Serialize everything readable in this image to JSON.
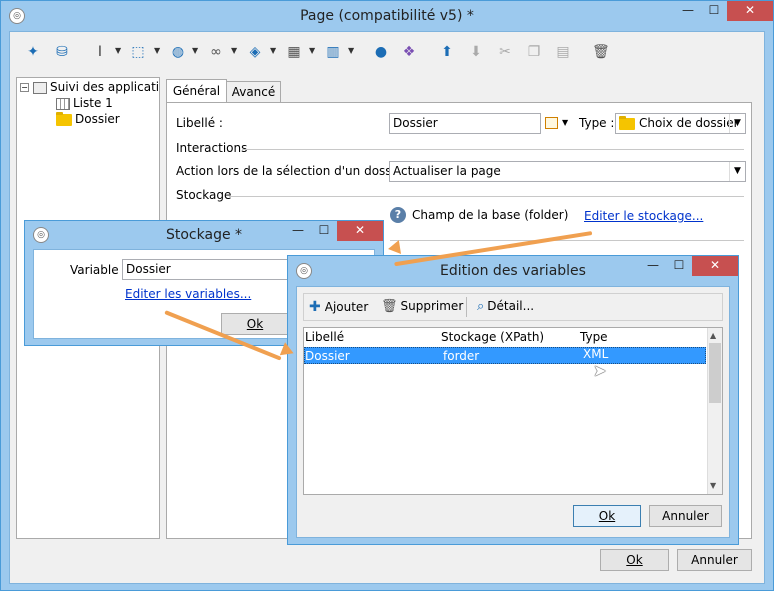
{
  "main": {
    "title": "Page (compatibilité v5) *",
    "tree": {
      "root": "Suivi des applications",
      "items": [
        "Liste 1",
        "Dossier"
      ]
    },
    "tabs": [
      {
        "label": "Général"
      },
      {
        "label": "Avancé"
      }
    ],
    "libelle_label": "Libellé :",
    "libelle_value": "Dossier",
    "type_label": "Type :",
    "type_value": "Choix de dossier",
    "interactions_label": "Interactions",
    "action_label": "Action lors de la sélection d'un dossier :",
    "action_value": "Actualiser la page",
    "stockage_label": "Stockage",
    "champ_label": "Champ de la base (folder)",
    "editer_stockage": "Editer le stockage...",
    "ok": "Ok",
    "annuler": "Annuler"
  },
  "stockage": {
    "title": "Stockage *",
    "variable_label": "Variable :",
    "variable_value": "Dossier",
    "editer_variables": "Editer les variables...",
    "ok": "Ok"
  },
  "edition": {
    "title": "Edition des variables",
    "toolbar": {
      "ajouter": "Ajouter",
      "supprimer": "Supprimer",
      "detail": "Détail..."
    },
    "columns": [
      "Libellé",
      "Stockage (XPath)",
      "Type"
    ],
    "rows": [
      [
        "Dossier",
        "forder",
        "XML"
      ]
    ],
    "ok": "Ok",
    "annuler": "Annuler"
  },
  "colors": {
    "selection": "#3399ff",
    "arrow": "#f0a050",
    "titlebar": "#9cc9ee",
    "close": "#c75050"
  }
}
